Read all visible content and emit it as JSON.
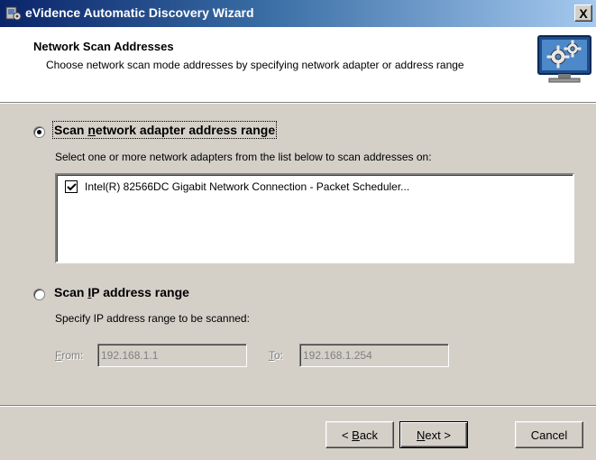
{
  "window": {
    "title": "eVidence Automatic Discovery Wizard",
    "close_glyph": "X",
    "icon": "wizard-app-icon"
  },
  "header": {
    "title": "Network Scan Addresses",
    "subtitle": "Choose network scan mode addresses by specifying network adapter or address range",
    "icon": "gears-monitor-icon"
  },
  "options": {
    "adapter": {
      "label": "Scan network adapter address range",
      "mnemonic_prefix": "Scan ",
      "mnemonic": "n",
      "mnemonic_suffix": "etwork adapter address range",
      "selected": true,
      "description": "Select one or more network adapters from the list below to scan addresses on:",
      "adapters": [
        {
          "label": "Intel(R) 82566DC Gigabit Network Connection - Packet Scheduler...",
          "checked": true
        }
      ]
    },
    "ip": {
      "label": "Scan IP address range",
      "mnemonic_prefix": "Scan ",
      "mnemonic": "I",
      "mnemonic_suffix": "P address range",
      "selected": false,
      "description": "Specify IP address range to be scanned:",
      "from_label_mn": "F",
      "from_label_rest": "rom:",
      "from_value": "192.168.1.1",
      "to_label_mn": "T",
      "to_label_rest": "o:",
      "to_value": "192.168.1.254"
    }
  },
  "buttons": {
    "back_prefix": "< ",
    "back_mn": "B",
    "back_rest": "ack",
    "next_mn": "N",
    "next_rest": "ext >",
    "cancel": "Cancel"
  },
  "colors": {
    "title_gradient_start": "#0a246a",
    "title_gradient_end": "#a6caf0",
    "dialog_face": "#d4d0c8"
  }
}
